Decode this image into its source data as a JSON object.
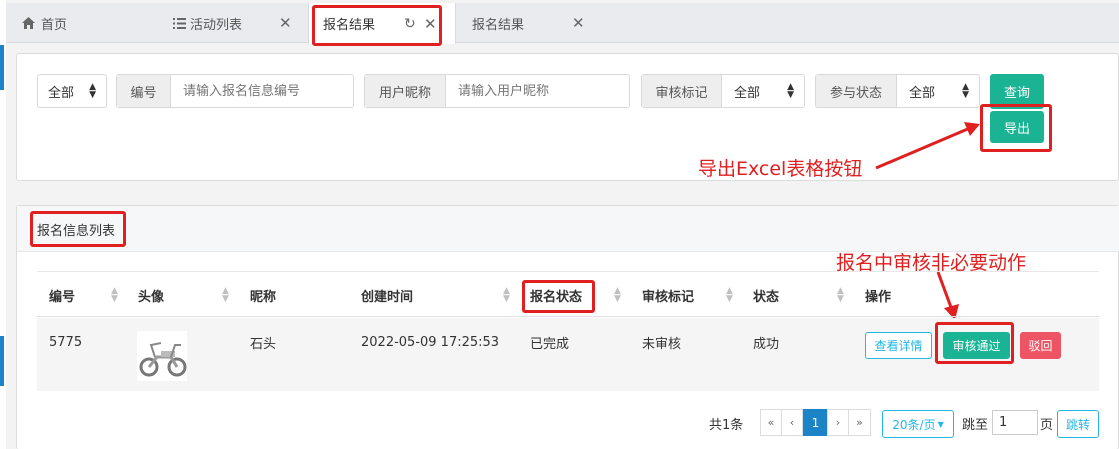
{
  "tabs": {
    "home": "首页",
    "activity_list": "活动列表",
    "signup_results_active": "报名结果",
    "signup_results": "报名结果"
  },
  "filters": {
    "scope_select": "全部",
    "number_label": "编号",
    "number_placeholder": "请输入报名信息编号",
    "nickname_label": "用户昵称",
    "nickname_placeholder": "请输入用户昵称",
    "review_label": "审核标记",
    "review_value": "全部",
    "participation_label": "参与状态",
    "participation_value": "全部",
    "query_button": "查询",
    "export_button": "导出"
  },
  "annotations": {
    "export_note": "导出Excel表格按钮",
    "review_note": "报名中审核非必要动作"
  },
  "list_panel": {
    "title": "报名信息列表"
  },
  "table": {
    "headers": [
      "编号",
      "头像",
      "昵称",
      "创建时间",
      "报名状态",
      "审核标记",
      "状态",
      "操作"
    ],
    "rows": [
      {
        "id": "5775",
        "avatar": "scooter photo",
        "nickname": "石头",
        "created": "2022-05-09 17:25:53",
        "signup_status": "已完成",
        "review_mark": "未审核",
        "status": "成功",
        "actions": {
          "detail": "查看详情",
          "approve": "审核通过",
          "reject": "驳回"
        }
      }
    ]
  },
  "pagination": {
    "total_text": "共1条",
    "first": "«",
    "prev": "‹",
    "current_page": "1",
    "next": "›",
    "last": "»",
    "page_size": "20条/页",
    "jump_label": "跳至",
    "jump_value": "1",
    "page_unit": "页",
    "jump_button": "跳转"
  },
  "colors": {
    "primary_green": "#1ab394",
    "info_blue": "#23b7e5",
    "danger_red": "#ed5565",
    "annotation_red": "#e02020",
    "page_blue": "#1c84c6"
  }
}
